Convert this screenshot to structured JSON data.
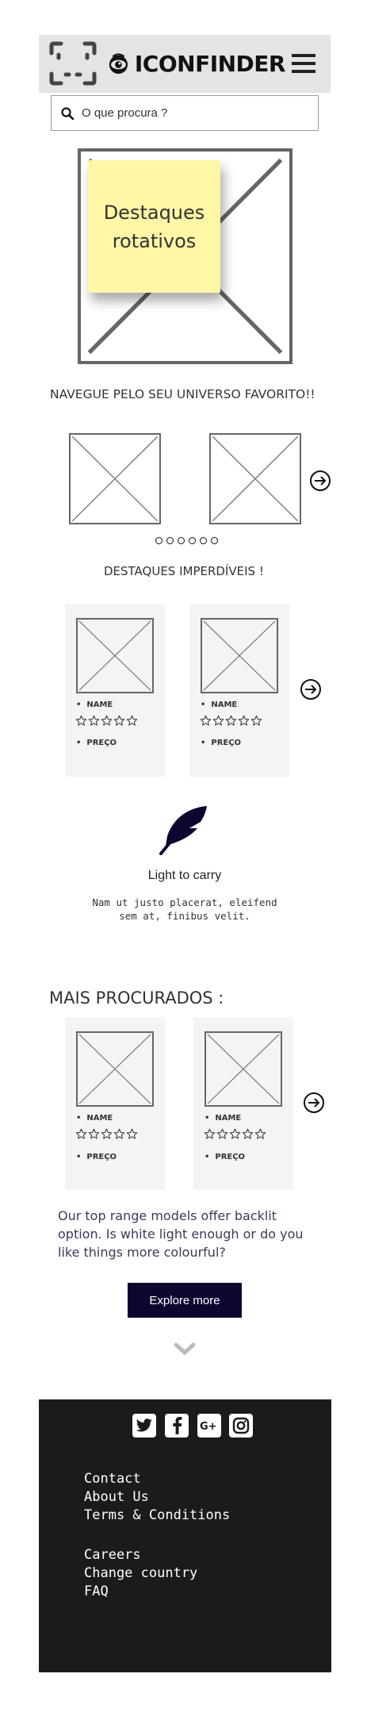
{
  "header": {
    "brand": "ICONFINDER"
  },
  "search": {
    "placeholder": "O que procura ?"
  },
  "hero": {
    "sticky_text": "Destaques rotativos"
  },
  "browse": {
    "title": "NAVEGUE PELO SEU UNIVERSO FAVORITO!!",
    "dot_count": 6
  },
  "highlights": {
    "title": "DESTAQUES IMPERDÍVEIS !",
    "cards": [
      {
        "name": "NAME",
        "price": "PREÇO",
        "rating": 0
      },
      {
        "name": "NAME",
        "price": "PREÇO",
        "rating": 0
      }
    ]
  },
  "feature": {
    "icon": "feather-icon",
    "title": "Light to carry",
    "text": "Nam ut justo placerat, eleifend sem at, finibus velit."
  },
  "most_searched": {
    "title": "MAIS PROCURADOS :",
    "cards": [
      {
        "name": "NAME",
        "price": "PREÇO",
        "rating": 0
      },
      {
        "name": "NAME",
        "price": "PREÇO",
        "rating": 0
      }
    ]
  },
  "promo": {
    "text": "Our top range models offer backlit option. Is white light enough or do you like things more colourful?",
    "button_label": "Explore more"
  },
  "footer": {
    "social": [
      "twitter-icon",
      "facebook-icon",
      "google-plus-icon",
      "instagram-icon"
    ],
    "links_1": [
      "Contact",
      "About Us",
      "Terms & Conditions"
    ],
    "links_2": [
      "Careers",
      "Change country",
      "FAQ"
    ]
  },
  "colors": {
    "accent": "#0d0630",
    "footer_bg": "#1b1b1b",
    "header_bg": "#e4e4e4",
    "sticky": "#fff6a6"
  }
}
